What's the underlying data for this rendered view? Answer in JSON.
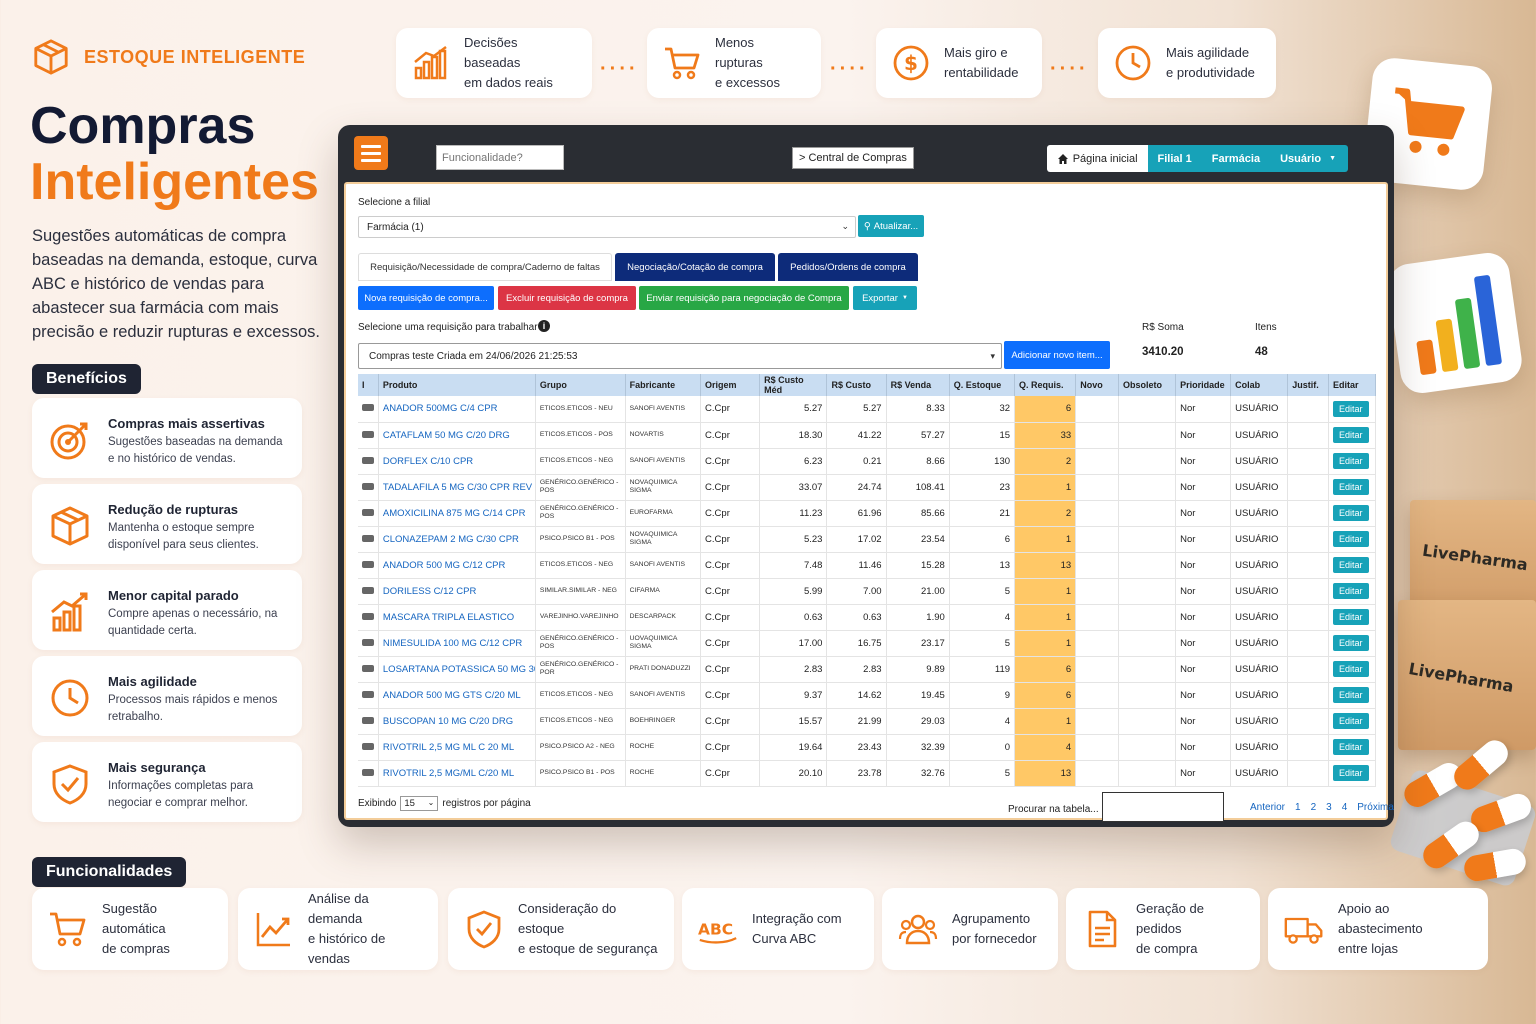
{
  "brand": {
    "name": "ESTOQUE INTELIGENTE"
  },
  "hero": {
    "title_line1": "Compras",
    "title_line2": "Inteligentes",
    "description": "Sugestões automáticas de compra baseadas na demanda, estoque, curva ABC e histórico de vendas para abastecer sua farmácia com mais precisão e reduzir rupturas e excessos."
  },
  "benefits_title": "Benefícios",
  "benefits": [
    {
      "title": "Compras mais assertivas",
      "text": "Sugestões baseadas na demanda e no histórico de vendas.",
      "icon": "target-icon"
    },
    {
      "title": "Redução de rupturas",
      "text": "Mantenha o estoque sempre disponível para seus clientes.",
      "icon": "box-icon"
    },
    {
      "title": "Menor capital parado",
      "text": "Compre apenas o necessário, na quantidade certa.",
      "icon": "growth-chart-icon"
    },
    {
      "title": "Mais agilidade",
      "text": "Processos mais rápidos e menos retrabalho.",
      "icon": "clock-icon"
    },
    {
      "title": "Mais segurança",
      "text": "Informações completas para negociar e comprar melhor.",
      "icon": "shield-check-icon"
    }
  ],
  "top_features": [
    {
      "label": "Decisões baseadas\nem dados reais",
      "icon": "bar-chart-icon"
    },
    {
      "label": "Menos rupturas\ne excessos",
      "icon": "cart-icon"
    },
    {
      "label": "Mais giro e\nrentabilidade",
      "icon": "dollar-icon"
    },
    {
      "label": "Mais agilidade\ne produtividade",
      "icon": "clock-icon"
    }
  ],
  "functions_title": "Funcionalidades",
  "functions": [
    {
      "label": "Sugestão automática\nde compras",
      "icon": "cart-icon"
    },
    {
      "label": "Análise da demanda\ne histórico de vendas",
      "icon": "trend-line-icon"
    },
    {
      "label": "Consideração do estoque\ne estoque de segurança",
      "icon": "shield-check-icon"
    },
    {
      "label": "Integração com\nCurva ABC",
      "icon": "abc-icon"
    },
    {
      "label": "Agrupamento\npor fornecedor",
      "icon": "users-icon"
    },
    {
      "label": "Geração de pedidos\nde compra",
      "icon": "document-icon"
    },
    {
      "label": "Apoio ao abastecimento\nentre lojas",
      "icon": "truck-icon"
    }
  ],
  "app": {
    "functionality_placeholder": "Funcionalidade?",
    "central_label": "> Central de Compras",
    "nav_home": "Página inicial",
    "nav_branch": "Filial 1",
    "nav_store": "Farmácia",
    "nav_user": "Usuário",
    "select_branch_label": "Selecione a filial",
    "branch_value": "Farmácia (1)",
    "refresh_label": "Atualizar...",
    "tabs": [
      "Requisição/Necessidade de compra/Caderno de faltas",
      "Negociação/Cotação de compra",
      "Pedidos/Ordens de compra"
    ],
    "actions": {
      "new_request": "Nova requisição de compra...",
      "delete_request": "Excluir requisição de compra",
      "send_request": "Enviar requisição para negociação de Compra",
      "export": "Exportar"
    },
    "select_request_label": "Selecione uma requisição para trabalhar",
    "request_value": "Compras teste Criada em 24/06/2026 21:25:53",
    "add_item": "Adicionar novo item...",
    "sum_label": "R$ Soma",
    "sum_value": "3410.20",
    "items_label": "Itens",
    "items_value": "48",
    "columns": [
      "I",
      "Produto",
      "Grupo",
      "Fabricante",
      "Origem",
      "R$ Custo Méd",
      "R$ Custo",
      "R$ Venda",
      "Q. Estoque",
      "Q. Requis.",
      "Novo",
      "Obsoleto",
      "Prioridade",
      "Colab",
      "Justif.",
      "Editar"
    ],
    "rows": [
      [
        "ANADOR 500MG C/4 CPR",
        "ETICOS.ETICOS - NEU",
        "SANOFI AVENTIS",
        "C.Cpr",
        "5.27",
        "5.27",
        "8.33",
        "32",
        "6",
        "Nor",
        "USUÁRIO"
      ],
      [
        "CATAFLAM 50 MG C/20 DRG",
        "ETICOS.ETICOS - POS",
        "NOVARTIS",
        "C.Cpr",
        "18.30",
        "41.22",
        "57.27",
        "15",
        "33",
        "Nor",
        "USUÁRIO"
      ],
      [
        "DORFLEX C/10 CPR",
        "ETICOS.ETICOS - NEG",
        "SANOFI AVENTIS",
        "C.Cpr",
        "6.23",
        "0.21",
        "8.66",
        "130",
        "2",
        "Nor",
        "USUÁRIO"
      ],
      [
        "TADALAFILA 5 MG C/30 CPR REV",
        "GENÉRICO.GENÉRICO - POS",
        "NOVAQUIMICA SIGMA",
        "C.Cpr",
        "33.07",
        "24.74",
        "108.41",
        "23",
        "1",
        "Nor",
        "USUÁRIO"
      ],
      [
        "AMOXICILINA 875 MG C/14 CPR",
        "GENÉRICO.GENÉRICO - POS",
        "EUROFARMA",
        "C.Cpr",
        "11.23",
        "61.96",
        "85.66",
        "21",
        "2",
        "Nor",
        "USUÁRIO"
      ],
      [
        "CLONAZEPAM 2 MG C/30 CPR",
        "PSICO.PSICO B1 - POS",
        "NOVAQUIMICA SIGMA",
        "C.Cpr",
        "5.23",
        "17.02",
        "23.54",
        "6",
        "1",
        "Nor",
        "USUÁRIO"
      ],
      [
        "ANADOR 500 MG C/12 CPR",
        "ETICOS.ETICOS - NEG",
        "SANOFI AVENTIS",
        "C.Cpr",
        "7.48",
        "11.46",
        "15.28",
        "13",
        "13",
        "Nor",
        "USUÁRIO"
      ],
      [
        "DORILESS C/12 CPR",
        "SIMILAR.SIMILAR - NEG",
        "CIFARMA",
        "C.Cpr",
        "5.99",
        "7.00",
        "21.00",
        "5",
        "1",
        "Nor",
        "USUÁRIO"
      ],
      [
        "MASCARA TRIPLA ELASTICO",
        "VAREJINHO.VAREJINHO",
        "DESCARPACK",
        "C.Cpr",
        "0.63",
        "0.63",
        "1.90",
        "4",
        "1",
        "Nor",
        "USUÁRIO"
      ],
      [
        "NIMESULIDA 100 MG C/12 CPR",
        "GENÉRICO.GENÉRICO - POS",
        "UOVAQUIMICA SIGMA",
        "C.Cpr",
        "17.00",
        "16.75",
        "23.17",
        "5",
        "1",
        "Nor",
        "USUÁRIO"
      ],
      [
        "LOSARTANA POTASSICA 50 MG 30",
        "GENÉRICO.GENÉRICO - POR",
        "PRATI DONADUZZI",
        "C.Cpr",
        "2.83",
        "2.83",
        "9.89",
        "119",
        "6",
        "Nor",
        "USUÁRIO"
      ],
      [
        "ANADOR 500 MG GTS C/20 ML",
        "ETICOS.ETICOS - NEG",
        "SANOFI AVENTIS",
        "C.Cpr",
        "9.37",
        "14.62",
        "19.45",
        "9",
        "6",
        "Nor",
        "USUÁRIO"
      ],
      [
        "BUSCOPAN 10 MG C/20 DRG",
        "ETICOS.ETICOS - NEG",
        "BOEHRINGER",
        "C.Cpr",
        "15.57",
        "21.99",
        "29.03",
        "4",
        "1",
        "Nor",
        "USUÁRIO"
      ],
      [
        "RIVOTRIL 2,5 MG ML C 20 ML",
        "PSICO.PSICO A2 - NEG",
        "ROCHE",
        "C.Cpr",
        "19.64",
        "23.43",
        "32.39",
        "0",
        "4",
        "Nor",
        "USUÁRIO"
      ],
      [
        "RIVOTRIL 2,5 MG/ML C/20 ML",
        "PSICO.PSICO B1 - POS",
        "ROCHE",
        "C.Cpr",
        "20.10",
        "23.78",
        "32.76",
        "5",
        "13",
        "Nor",
        "USUÁRIO"
      ]
    ],
    "edit_label": "Editar",
    "showing_label": "Exibindo",
    "page_size": "15",
    "per_page_label": "registros por página",
    "search_label": "Procurar na tabela...",
    "pager": {
      "prev": "Anterior",
      "pages": [
        "1",
        "2",
        "3",
        "4"
      ],
      "next": "Próxima"
    }
  },
  "deco": {
    "box_brand": "LivePharma"
  },
  "colors": {
    "accent": "#f07a1a",
    "dark": "#1f2433",
    "teal": "#17a2b8",
    "navy": "#0d2b7a"
  }
}
